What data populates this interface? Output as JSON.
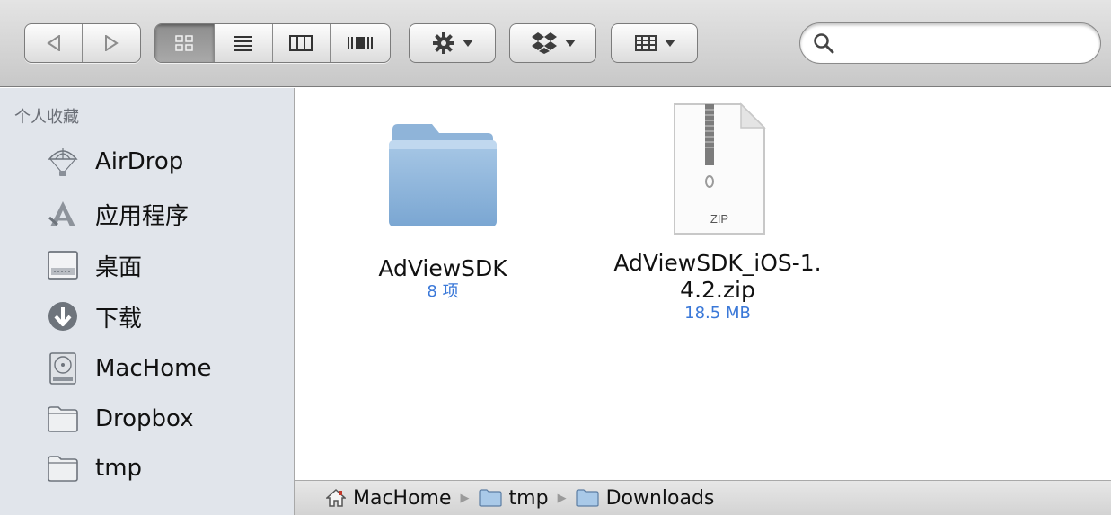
{
  "toolbar": {
    "nav": {
      "back_icon": "chevron-left-icon",
      "forward_icon": "chevron-right-icon"
    },
    "view_modes": [
      "icon-view",
      "list-view",
      "column-view",
      "cover-flow-view"
    ],
    "active_view": "icon-view",
    "action_icon": "gear-icon",
    "dropbox_icon": "dropbox-icon",
    "arrange_icon": "arrange-grid-icon",
    "search": {
      "placeholder": "",
      "value": ""
    }
  },
  "sidebar": {
    "heading": "个人收藏",
    "items": [
      {
        "label": "AirDrop",
        "icon": "airdrop-icon"
      },
      {
        "label": "应用程序",
        "icon": "applications-icon"
      },
      {
        "label": "桌面",
        "icon": "desktop-icon"
      },
      {
        "label": "下载",
        "icon": "downloads-icon"
      },
      {
        "label": "MacHome",
        "icon": "hard-drive-icon"
      },
      {
        "label": "Dropbox",
        "icon": "folder-icon"
      },
      {
        "label": "tmp",
        "icon": "folder-icon"
      }
    ]
  },
  "files": [
    {
      "name": "AdViewSDK",
      "meta": "8 项",
      "icon": "folder-icon"
    },
    {
      "name_line1": "AdViewSDK_iOS-1.",
      "name_line2": "4.2.zip",
      "meta": "18.5 MB",
      "icon": "zip-file-icon",
      "zip_label": "ZIP"
    }
  ],
  "path_bar": [
    {
      "label": "MacHome",
      "icon": "home-icon"
    },
    {
      "label": "tmp",
      "icon": "folder-icon"
    },
    {
      "label": "Downloads",
      "icon": "folder-icon"
    }
  ],
  "colors": {
    "accent_meta": "#3a78d8",
    "sidebar_bg": "#e1e5eb",
    "folder_blue": "#8fb4d9"
  }
}
